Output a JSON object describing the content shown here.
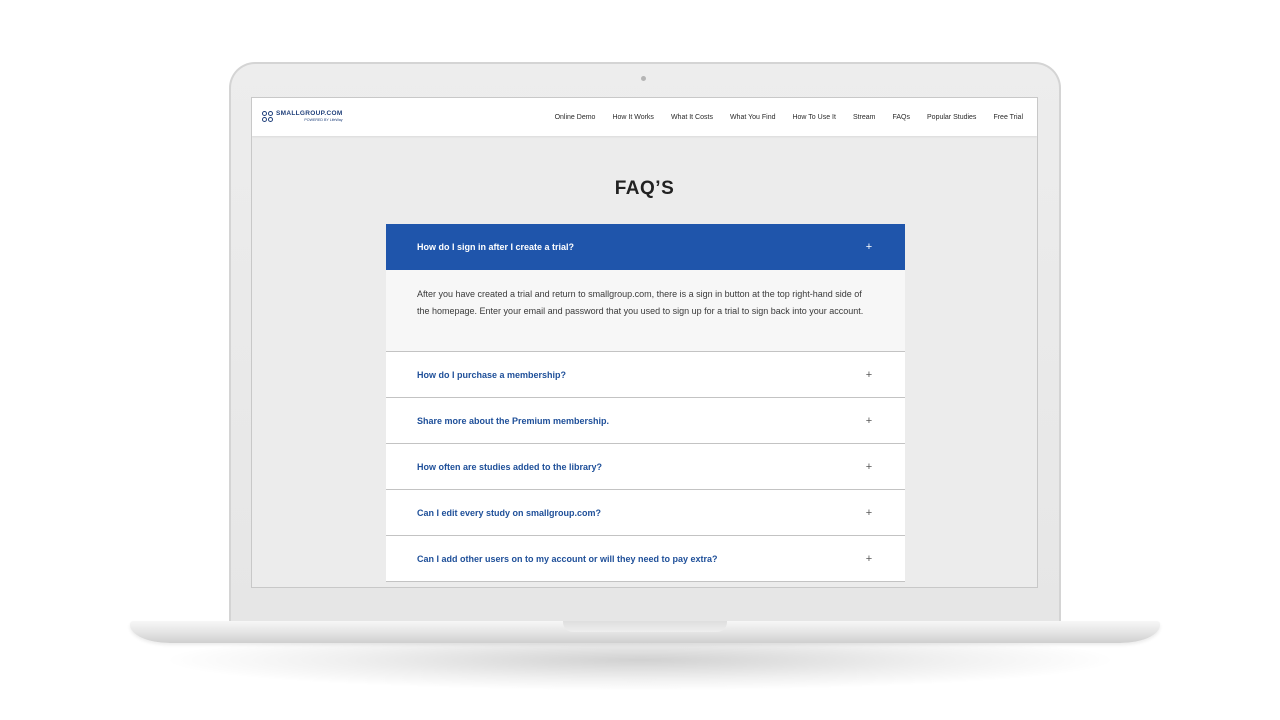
{
  "site": {
    "logo_name": "SMALLGROUP.COM",
    "logo_tagline": "POWERED BY LifeWay"
  },
  "nav": {
    "items": [
      "Online Demo",
      "How It Works",
      "What It Costs",
      "What You Find",
      "How To Use It",
      "Stream",
      "FAQs",
      "Popular Studies",
      "Free Trial"
    ]
  },
  "page": {
    "title": "FAQ’S"
  },
  "faq": {
    "expanded": {
      "question": "How do I sign in after I create a trial?",
      "answer": "After you have created a trial and return to smallgroup.com, there is a sign in button at the top right-hand side of the homepage. Enter your email and password that you used to sign up for a trial to sign back into your account."
    },
    "items": [
      "How do I purchase a membership?",
      "Share more about the Premium membership.",
      "How often are studies added to the library?",
      "Can I edit every study on smallgroup.com?",
      "Can I add other users on to my account or will they need to pay extra?"
    ],
    "toggle_symbol": "+"
  },
  "colors": {
    "accent": "#1f55ab",
    "question_text": "#1e4f99",
    "page_bg": "#ececec"
  }
}
